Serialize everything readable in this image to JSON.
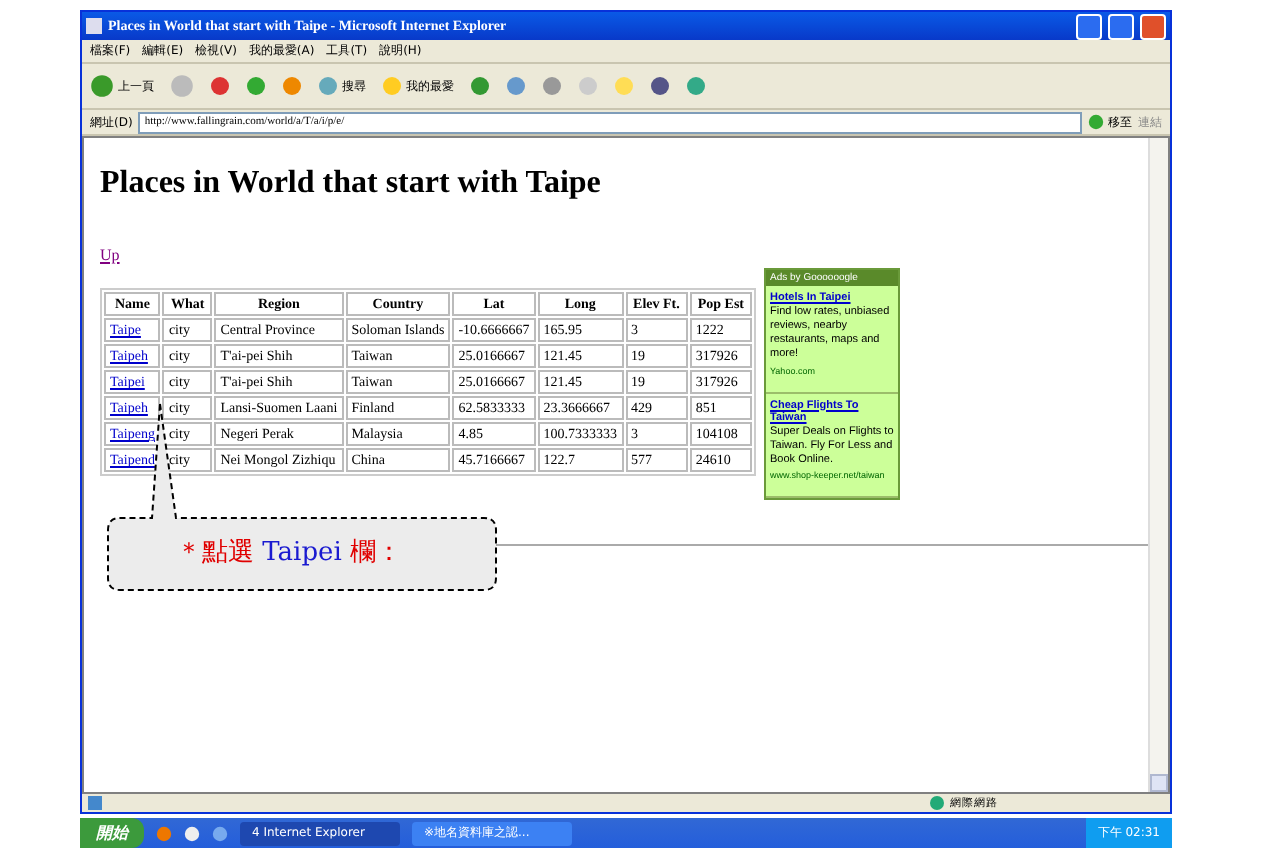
{
  "window": {
    "title": "Places in World that start with Taipe - Microsoft Internet Explorer"
  },
  "menu": [
    "檔案(F)",
    "編輯(E)",
    "檢視(V)",
    "我的最愛(A)",
    "工具(T)",
    "說明(H)"
  ],
  "toolbar": {
    "back": "上一頁",
    "search": "搜尋",
    "favorites": "我的最愛"
  },
  "address": {
    "label": "網址(D)",
    "value": "http://www.fallingrain.com/world/a/T/a/i/p/e/",
    "go": "移至",
    "links": "連結"
  },
  "page": {
    "heading": "Places in World that start with Taipe",
    "up_link": "Up",
    "table": {
      "columns": [
        "Name",
        "What",
        "Region",
        "Country",
        "Lat",
        "Long",
        "Elev Ft.",
        "Pop Est"
      ],
      "rows": [
        [
          "Taipe",
          "city",
          "Central Province",
          "Soloman Islands",
          "-10.6666667",
          "165.95",
          "3",
          "1222"
        ],
        [
          "Taipeh",
          "city",
          "T'ai-pei Shih",
          "Taiwan",
          "25.0166667",
          "121.45",
          "19",
          "317926"
        ],
        [
          "Taipei",
          "city",
          "T'ai-pei Shih",
          "Taiwan",
          "25.0166667",
          "121.45",
          "19",
          "317926"
        ],
        [
          "Taipeh",
          "city",
          "Lansi-Suomen Laani",
          "Finland",
          "62.5833333",
          "23.3666667",
          "429",
          "851"
        ],
        [
          "Taipeng",
          "city",
          "Negeri Perak",
          "Malaysia",
          "4.85",
          "100.7333333",
          "3",
          "104108"
        ],
        [
          "Taipend",
          "city",
          "Nei Mongol Zizhiqu",
          "China",
          "45.7166667",
          "122.7",
          "577",
          "24610"
        ]
      ]
    },
    "ads": {
      "header": "Ads by Goooooogle",
      "items": [
        {
          "title": "Hotels In Taipei",
          "body": "Find low rates, unbiased reviews, nearby restaurants, maps and more!",
          "url": "Yahoo.com"
        },
        {
          "title": "Cheap Flights To Taiwan",
          "body": "Super Deals on Flights to Taiwan. Fly For Less and Book Online.",
          "url": "www.shop-keeper.net/taiwan"
        }
      ]
    }
  },
  "callout": {
    "parts": [
      {
        "text": "＊點選",
        "color": "#e00000"
      },
      {
        "text": "Taipei",
        "color": "#1a1ad0"
      },
      {
        "text": "欄：",
        "color": "#e00000"
      }
    ]
  },
  "status_bar": {
    "zone": "網際網路"
  },
  "taskbar": {
    "start": "開始",
    "tasks": [
      {
        "label": "4 Internet Explorer",
        "selected": true
      },
      {
        "label": "※地名資料庫之認...",
        "selected": false
      }
    ],
    "clock": "下午 02:31"
  }
}
